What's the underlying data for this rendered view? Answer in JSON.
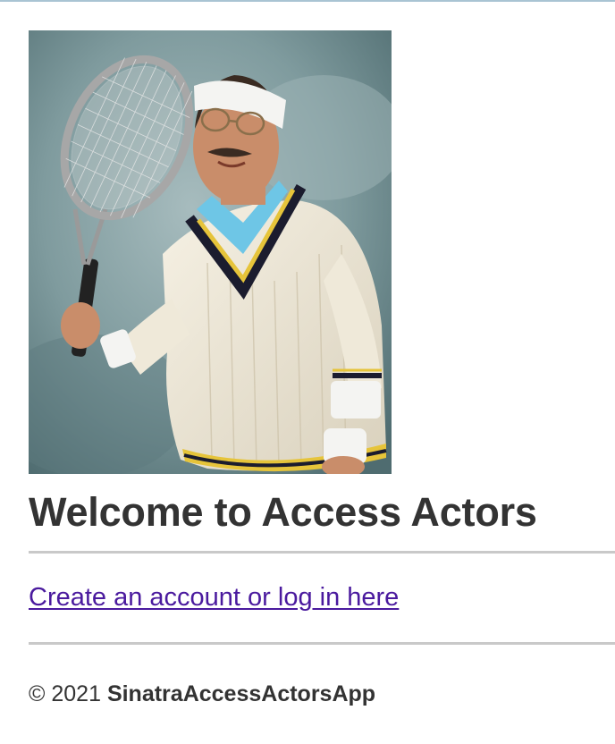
{
  "hero_image": {
    "alt": "Man in tennis outfit holding a racket",
    "colors": {
      "backdrop": "#7f9b9e",
      "sweater": "#efe9d9",
      "stripe_navy": "#1b1c2e",
      "stripe_yellow": "#e6c43a",
      "collar": "#6ec6e6",
      "skin": "#c98d6a",
      "headband": "#f4f4f2"
    }
  },
  "heading": "Welcome to Access Actors",
  "link": {
    "label": "Create an account or log in here",
    "color": "#4a1a9e"
  },
  "footer": {
    "copyright": "© 2021",
    "app_name": "SinatraAccessActorsApp"
  }
}
